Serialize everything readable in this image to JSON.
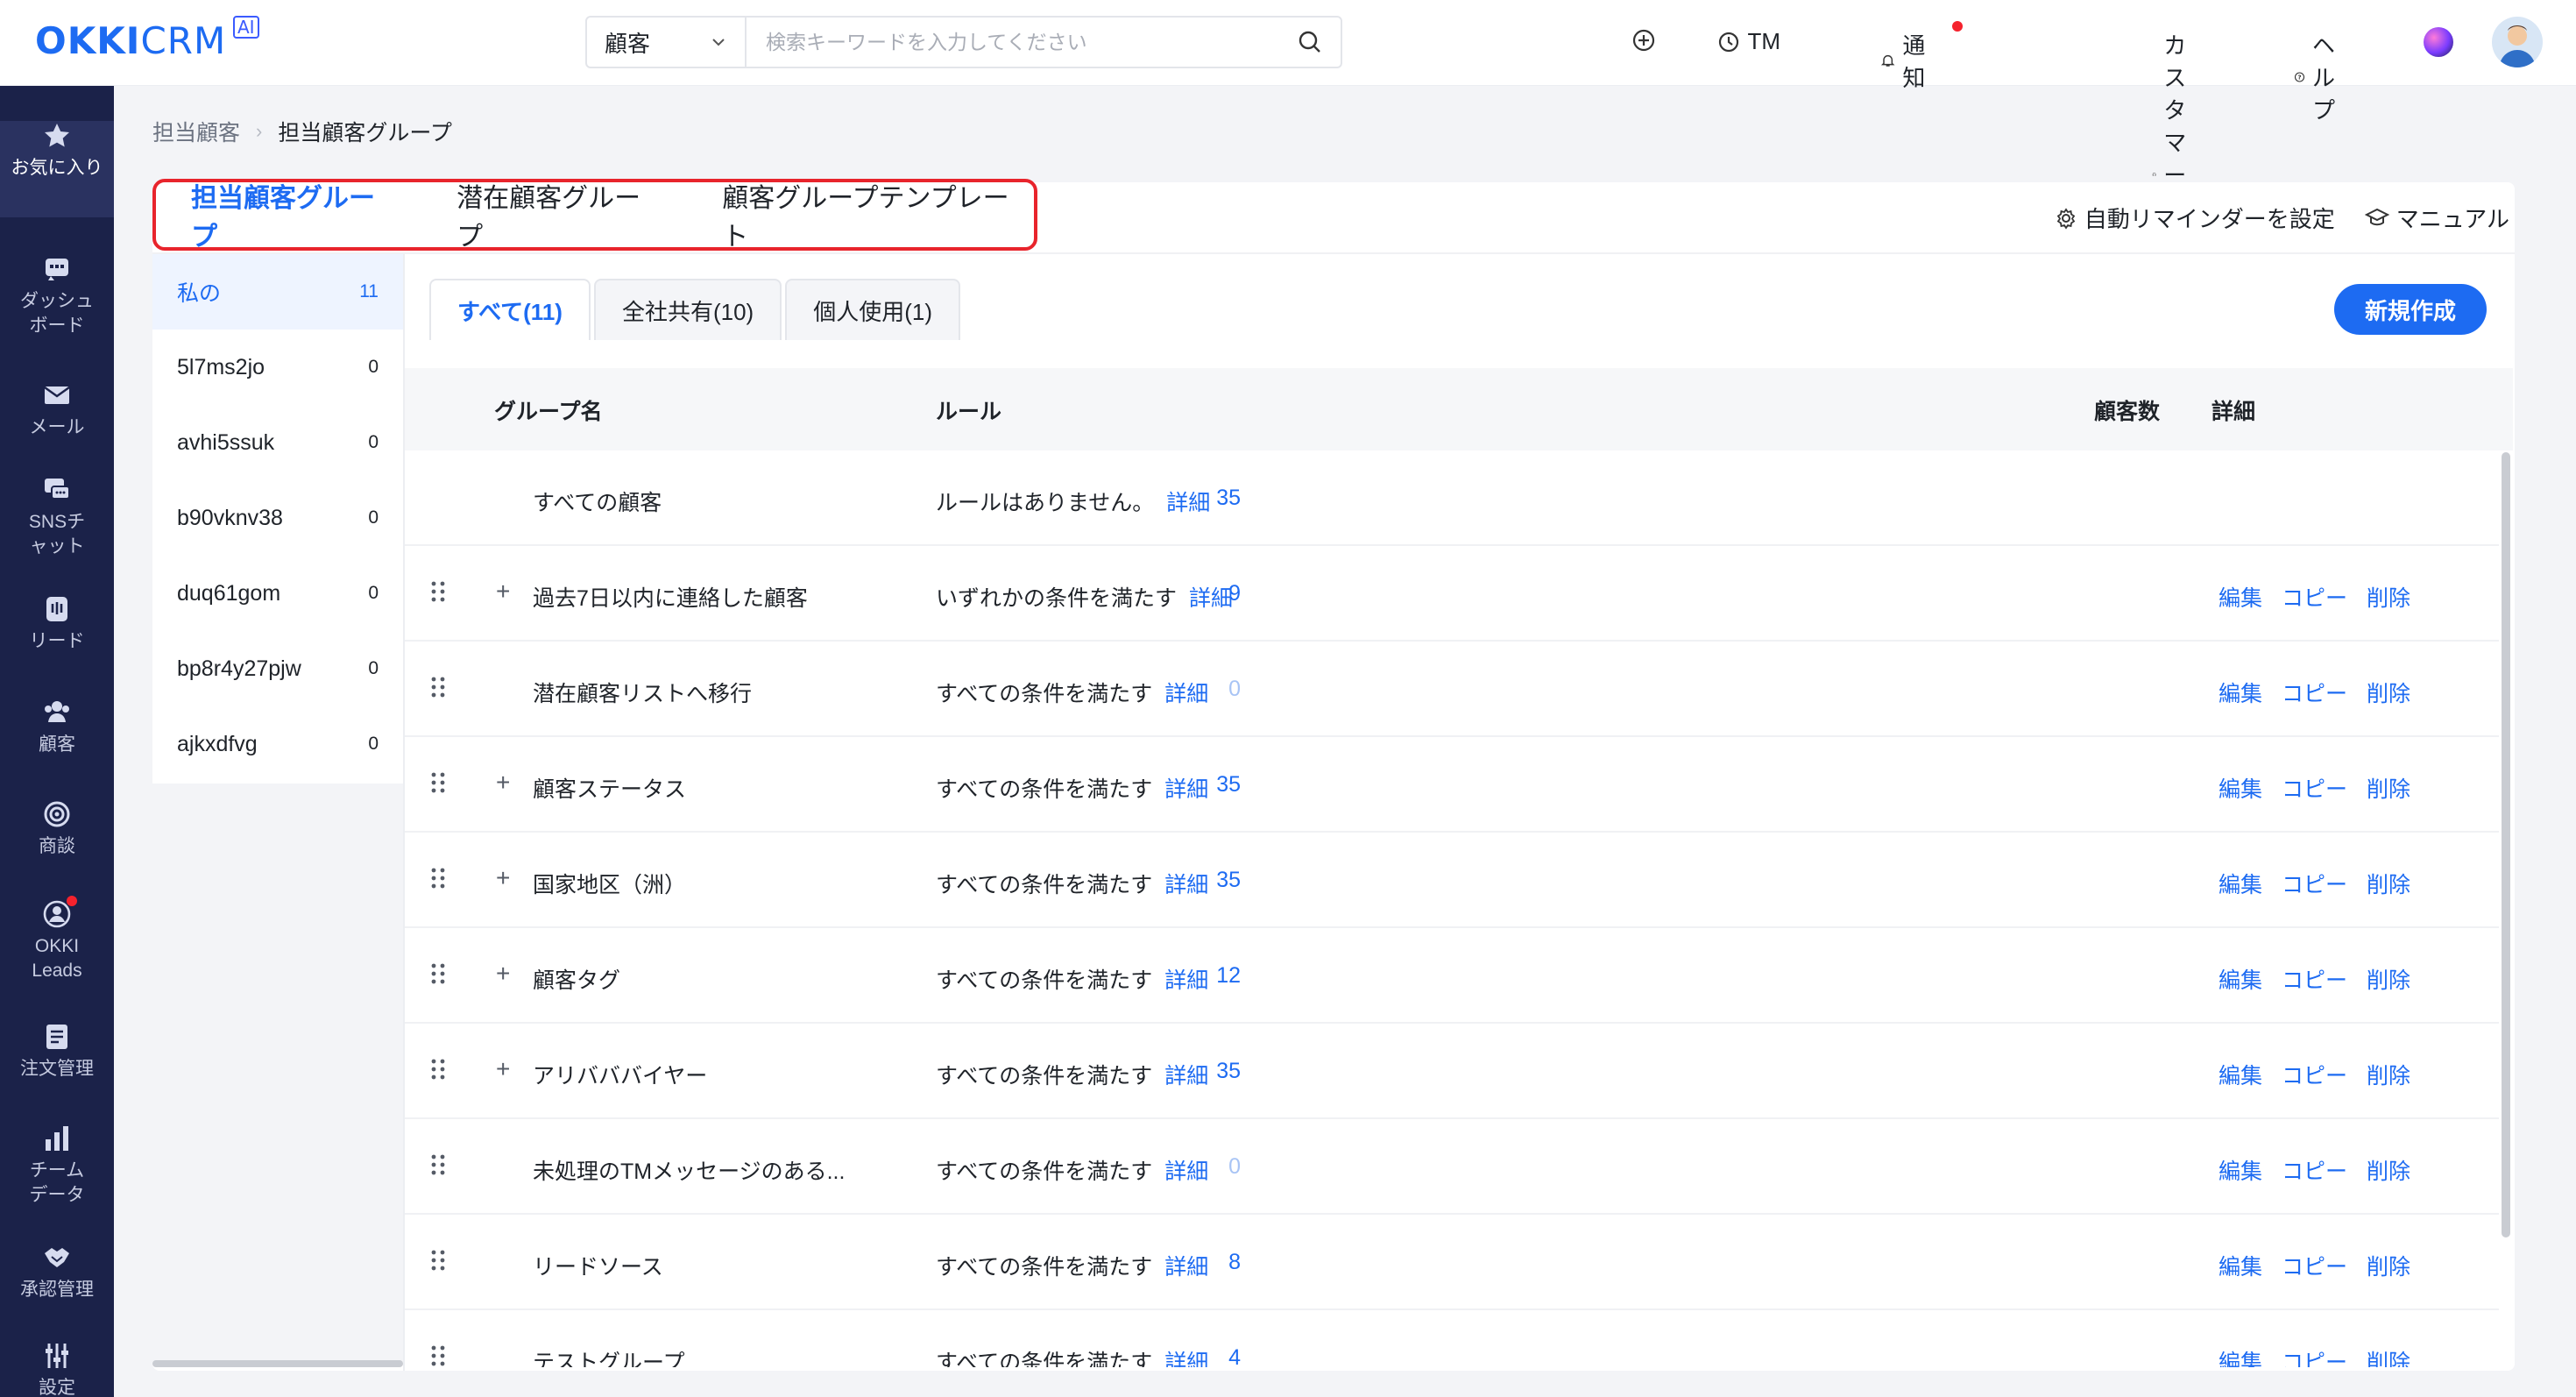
{
  "header": {
    "logo_text": "OKKI",
    "logo_text2": "CRM",
    "logo_badge": "AI",
    "search_scope": "顧客",
    "search_placeholder": "検索キーワードを入力してください",
    "nav": {
      "tm": "TM",
      "notifications": "通知",
      "support": "カスタマーサポート",
      "help": "ヘルプ"
    }
  },
  "sidebar": {
    "items": [
      {
        "label": "お気に入り",
        "icon": "star-icon"
      },
      {
        "label": "ダッシュボード",
        "icon": "dashboard-icon"
      },
      {
        "label": "メール",
        "icon": "mail-icon"
      },
      {
        "label": "SNSチャット",
        "icon": "chat-icon"
      },
      {
        "label": "リード",
        "icon": "lead-icon"
      },
      {
        "label": "顧客",
        "icon": "customers-icon"
      },
      {
        "label": "商談",
        "icon": "target-icon"
      },
      {
        "label": "OKKI Leads",
        "icon": "okki-leads-icon"
      },
      {
        "label": "注文管理",
        "icon": "order-icon"
      },
      {
        "label": "チームデータ",
        "icon": "bar-chart-icon"
      },
      {
        "label": "承認管理",
        "icon": "handshake-icon"
      },
      {
        "label": "設定",
        "icon": "settings-icon"
      }
    ]
  },
  "breadcrumb": {
    "parent": "担当顧客",
    "current": "担当顧客グループ"
  },
  "main_tabs": [
    "担当顧客グループ",
    "潜在顧客グループ",
    "顧客グループテンプレート"
  ],
  "actions": {
    "reminder": "自動リマインダーを設定",
    "manual": "マニュアル"
  },
  "left_list": [
    {
      "label": "私の",
      "count": "11"
    },
    {
      "label": "5l7ms2jo",
      "count": "0"
    },
    {
      "label": "avhi5ssuk",
      "count": "0"
    },
    {
      "label": "b90vknv38",
      "count": "0"
    },
    {
      "label": "duq61gom",
      "count": "0"
    },
    {
      "label": "bp8r4y27pjw",
      "count": "0"
    },
    {
      "label": "ajkxdfvg",
      "count": "0"
    }
  ],
  "sub_tabs": [
    "すべて(11)",
    "全社共有(10)",
    "個人使用(1)"
  ],
  "new_button": "新規作成",
  "table": {
    "headers": {
      "name": "グループ名",
      "rule": "ルール",
      "count": "顧客数",
      "detail": "詳細"
    },
    "detail_link": "詳細",
    "actions": {
      "edit": "編集",
      "copy": "コピー",
      "delete": "削除"
    },
    "rows": [
      {
        "name": "すべての顧客",
        "rule": "ルールはありません。",
        "count": "35"
      },
      {
        "name": "過去7日以内に連絡した顧客",
        "rule": "いずれかの条件を満たす",
        "count": "9"
      },
      {
        "name": "潜在顧客リストへ移行",
        "rule": "すべての条件を満たす",
        "count": "0"
      },
      {
        "name": "顧客ステータス",
        "rule": "すべての条件を満たす",
        "count": "35"
      },
      {
        "name": "国家地区（洲）",
        "rule": "すべての条件を満たす",
        "count": "35"
      },
      {
        "name": "顧客タグ",
        "rule": "すべての条件を満たす",
        "count": "12"
      },
      {
        "name": "アリバババイヤー",
        "rule": "すべての条件を満たす",
        "count": "35"
      },
      {
        "name": "未処理のTMメッセージのある...",
        "rule": "すべての条件を満たす",
        "count": "0"
      },
      {
        "name": "リードソース",
        "rule": "すべての条件を満たす",
        "count": "8"
      },
      {
        "name": "テストグループ",
        "rule": "すべての条件を満たす",
        "count": "4"
      }
    ]
  }
}
